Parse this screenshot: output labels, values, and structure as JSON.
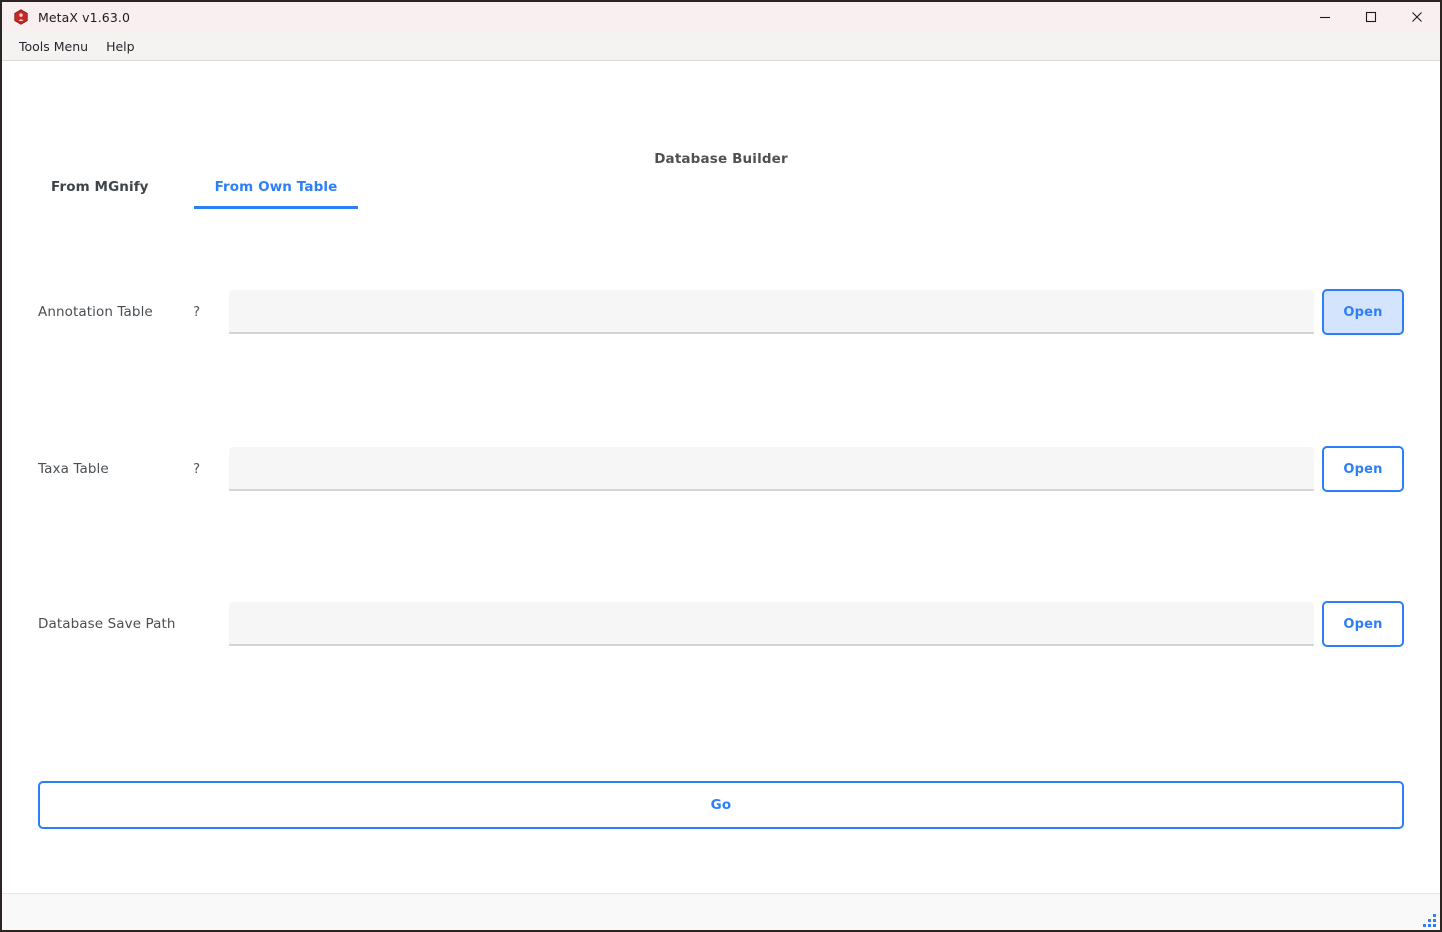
{
  "window": {
    "title": "MetaX v1.63.0",
    "app_icon": "metax-hexagon-icon",
    "controls": {
      "minimize": "minimize-icon",
      "maximize": "maximize-icon",
      "close": "close-icon"
    }
  },
  "menubar": {
    "items": [
      {
        "label": "Tools Menu"
      },
      {
        "label": "Help"
      }
    ]
  },
  "page": {
    "title": "Database Builder"
  },
  "tabs": [
    {
      "label": "From MGnify",
      "active": false
    },
    {
      "label": "From Own Table",
      "active": true
    }
  ],
  "form": {
    "rows": [
      {
        "label": "Annotation Table",
        "help": "?",
        "value": "",
        "placeholder": "",
        "button_label": "Open",
        "button_focused": true
      },
      {
        "label": "Taxa Table",
        "help": "?",
        "value": "",
        "placeholder": "",
        "button_label": "Open",
        "button_focused": false
      },
      {
        "label": "Database Save Path",
        "help": "",
        "value": "",
        "placeholder": "",
        "button_label": "Open",
        "button_focused": false
      }
    ],
    "submit_label": "Go"
  },
  "statusbar": {
    "text": "",
    "grip": "resize-grip-icon"
  },
  "colors": {
    "accent": "#2d7ff9",
    "accent_fill": "#d4e4fd",
    "titlebar_bg": "#faeff0",
    "menubar_bg": "#f5f2f2",
    "input_bg": "#f6f6f6",
    "page_title": "#4e5255",
    "icon_red": "#c62828"
  }
}
